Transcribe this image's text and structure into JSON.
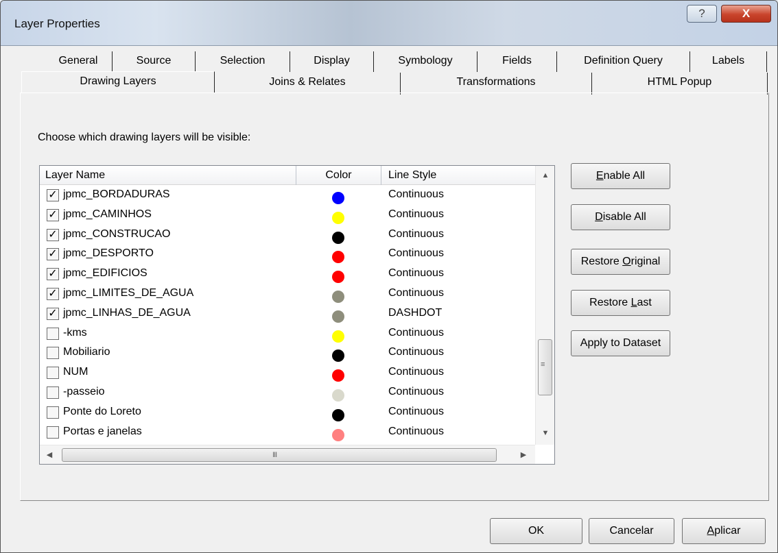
{
  "window": {
    "title": "Layer Properties",
    "help_glyph": "?",
    "close_glyph": "X"
  },
  "tabs_row1": [
    "General",
    "Source",
    "Selection",
    "Display",
    "Symbology",
    "Fields",
    "Definition Query",
    "Labels"
  ],
  "tabs_row2": [
    "Drawing Layers",
    "Joins & Relates",
    "Transformations",
    "HTML Popup"
  ],
  "active_tab": "Drawing Layers",
  "instructions": "Choose which drawing layers will be visible:",
  "columns": [
    "Layer Name",
    "Color",
    "Line Style"
  ],
  "layers": [
    {
      "name": "jpmc_BORDADURAS",
      "checked": true,
      "color": "#0000ff",
      "style": "Continuous"
    },
    {
      "name": "jpmc_CAMINHOS",
      "checked": true,
      "color": "#ffff00",
      "style": "Continuous"
    },
    {
      "name": "jpmc_CONSTRUCAO",
      "checked": true,
      "color": "#000000",
      "style": "Continuous"
    },
    {
      "name": "jpmc_DESPORTO",
      "checked": true,
      "color": "#ff0000",
      "style": "Continuous"
    },
    {
      "name": "jpmc_EDIFICIOS",
      "checked": true,
      "color": "#ff0000",
      "style": "Continuous"
    },
    {
      "name": "jpmc_LIMITES_DE_AGUA",
      "checked": true,
      "color": "#8e8e7c",
      "style": "Continuous"
    },
    {
      "name": "jpmc_LINHAS_DE_AGUA",
      "checked": true,
      "color": "#8e8e7c",
      "style": "DASHDOT"
    },
    {
      "name": "-kms",
      "checked": false,
      "color": "#ffff00",
      "style": "Continuous"
    },
    {
      "name": "Mobiliario",
      "checked": false,
      "color": "#000000",
      "style": "Continuous"
    },
    {
      "name": "NUM",
      "checked": false,
      "color": "#ff0000",
      "style": "Continuous"
    },
    {
      "name": "-passeio",
      "checked": false,
      "color": "#d9d9cc",
      "style": "Continuous"
    },
    {
      "name": "Ponte do Loreto",
      "checked": false,
      "color": "#000000",
      "style": "Continuous"
    },
    {
      "name": "Portas e janelas",
      "checked": false,
      "color": "#ff8080",
      "style": "Continuous"
    }
  ],
  "check_glyph": "✓",
  "side_buttons": {
    "enable_all": {
      "pre": "",
      "key": "E",
      "post": "nable All"
    },
    "disable_all": {
      "pre": "",
      "key": "D",
      "post": "isable All"
    },
    "restore_original": {
      "pre": "Restore ",
      "key": "O",
      "post": "riginal"
    },
    "restore_last": {
      "pre": "Restore ",
      "key": "L",
      "post": "ast"
    },
    "apply_to_dataset": {
      "pre": "Apply to Dataset",
      "key": "",
      "post": ""
    }
  },
  "footer_buttons": {
    "ok": {
      "pre": "OK",
      "key": "",
      "post": ""
    },
    "cancel": {
      "pre": "Cancelar",
      "key": "",
      "post": ""
    },
    "apply": {
      "pre": "",
      "key": "A",
      "post": "plicar"
    }
  },
  "scroll_glyphs": {
    "up": "▲",
    "down": "▼",
    "left": "◀",
    "right": "▶",
    "grip_v": "≡",
    "grip_h": "III"
  }
}
